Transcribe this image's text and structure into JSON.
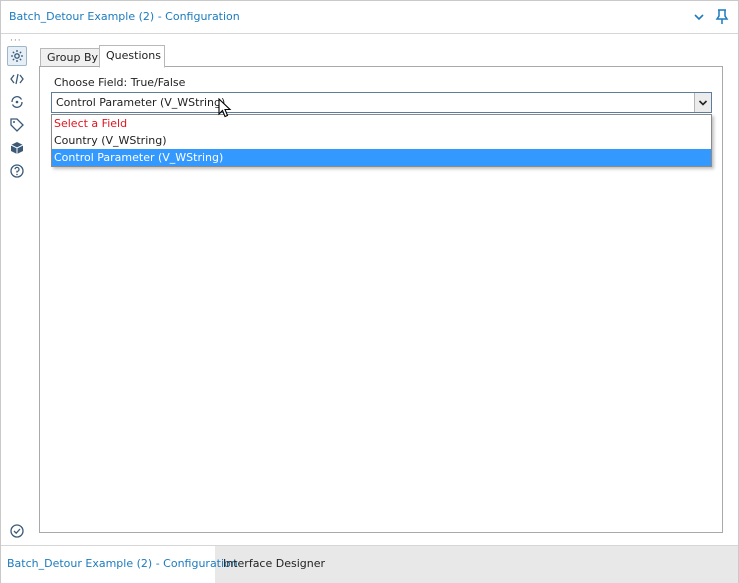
{
  "window": {
    "title": "Batch_Detour Example (2) - Configuration"
  },
  "tabs": [
    {
      "label": "Group By",
      "active": false
    },
    {
      "label": "Questions",
      "active": true
    }
  ],
  "form": {
    "field_label": "Choose Field: True/False",
    "select_value": "Control Parameter (V_WString)",
    "options": [
      {
        "label": "Select a Field",
        "kind": "placeholder"
      },
      {
        "label": "Country (V_WString)",
        "kind": "normal"
      },
      {
        "label": "Control Parameter (V_WString)",
        "kind": "selected"
      }
    ]
  },
  "bottom_tabs": [
    {
      "label": "Batch_Detour Example (2) - Configuration",
      "active": true
    },
    {
      "label": "Interface Designer",
      "active": false
    }
  ],
  "colors": {
    "accent": "#1c7bbf",
    "selection": "#3399ff",
    "placeholder_red": "#e0141e"
  },
  "icons": {
    "toolbar": [
      "gear-icon",
      "code-icon",
      "refresh-icon",
      "tag-icon",
      "box-icon",
      "help-icon"
    ],
    "bottom": "check-circle-icon",
    "title": [
      "chevron-down-icon",
      "pin-icon"
    ]
  }
}
